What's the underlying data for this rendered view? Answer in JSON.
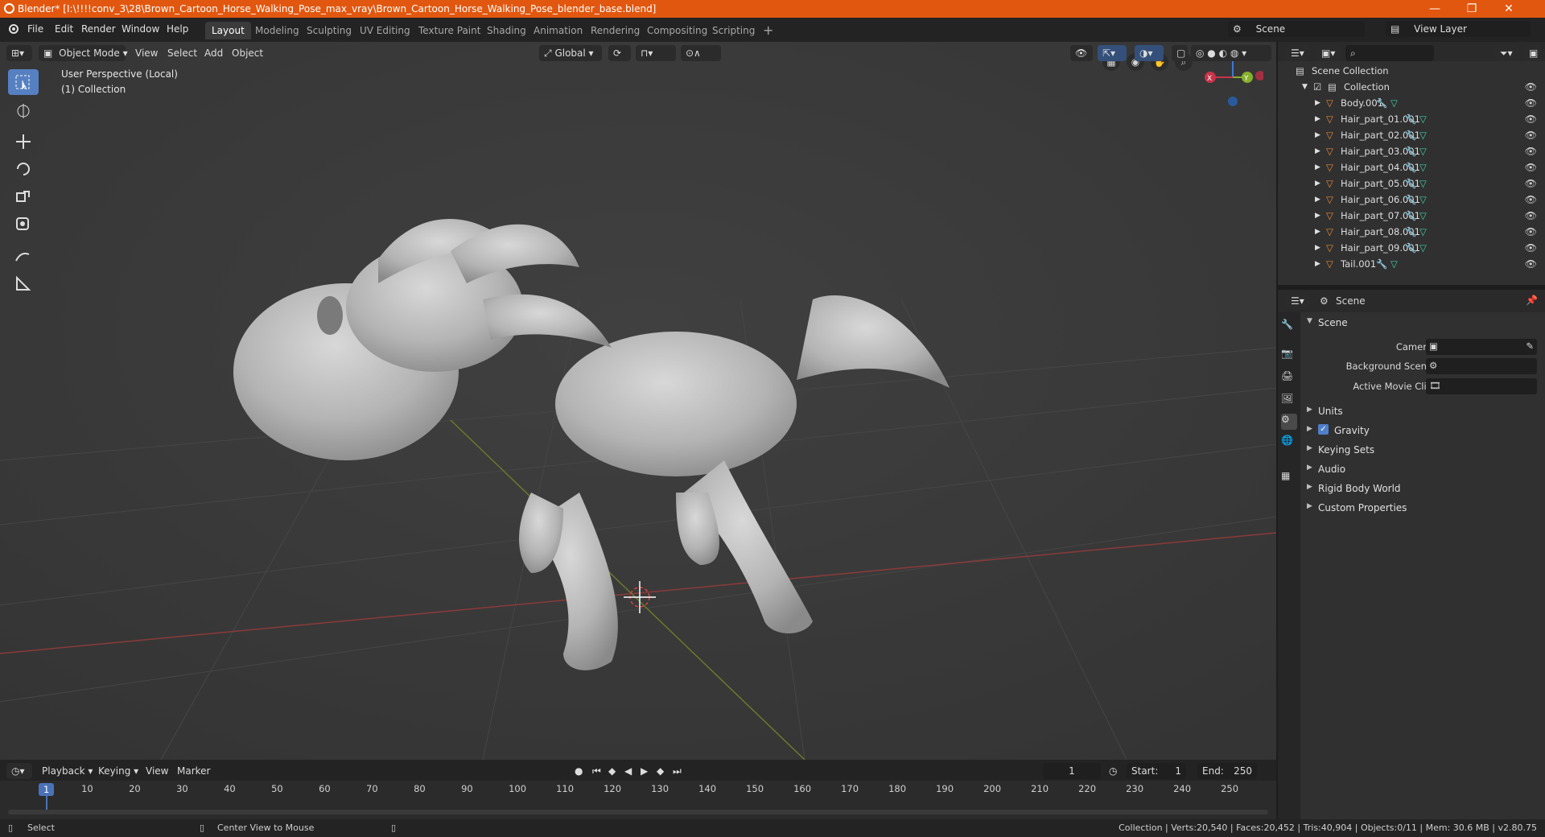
{
  "window": {
    "title": "Blender* [I:\\!!!!conv_3\\28\\Brown_Cartoon_Horse_Walking_Pose_max_vray\\Brown_Cartoon_Horse_Walking_Pose_blender_base.blend]",
    "minimize": "—",
    "maximize": "❐",
    "close": "✕"
  },
  "menu": [
    "File",
    "Edit",
    "Render",
    "Window",
    "Help"
  ],
  "workspaces": [
    "Layout",
    "Modeling",
    "Sculpting",
    "UV Editing",
    "Texture Paint",
    "Shading",
    "Animation",
    "Rendering",
    "Compositing",
    "Scripting"
  ],
  "workspace_add": "+",
  "active_workspace": "Layout",
  "scene_selector": "Scene",
  "view_layer_selector": "View Layer",
  "viewport_header": {
    "mode": "Object Mode",
    "menus": [
      "View",
      "Select",
      "Add",
      "Object"
    ],
    "orientation": "Global"
  },
  "viewport": {
    "perspective_label": "User Perspective (Local)",
    "collection_label": "(1) Collection",
    "gizmo": {
      "x": "X",
      "y": "Y",
      "z": "Z"
    }
  },
  "outliner": {
    "root": "Scene Collection",
    "collection": "Collection",
    "objects": [
      "Body.001",
      "Hair_part_01.001",
      "Hair_part_02.001",
      "Hair_part_03.001",
      "Hair_part_04.001",
      "Hair_part_05.001",
      "Hair_part_06.001",
      "Hair_part_07.001",
      "Hair_part_08.001",
      "Hair_part_09.001",
      "Tail.001"
    ]
  },
  "properties": {
    "header": "Scene",
    "section_title": "Scene",
    "fields": [
      {
        "label": "Camera"
      },
      {
        "label": "Background Scene"
      },
      {
        "label": "Active Movie Clip"
      }
    ],
    "panels": [
      "Units",
      "Gravity",
      "Keying Sets",
      "Audio",
      "Rigid Body World",
      "Custom Properties"
    ],
    "gravity_checked": true
  },
  "timeline": {
    "menus": [
      "Playback",
      "Keying",
      "View",
      "Marker"
    ],
    "current_frame": "1",
    "start_label": "Start:",
    "start": "1",
    "end_label": "End:",
    "end": "250",
    "ticks": [
      "1",
      "10",
      "20",
      "30",
      "40",
      "50",
      "60",
      "70",
      "80",
      "90",
      "100",
      "110",
      "120",
      "130",
      "140",
      "150",
      "160",
      "170",
      "180",
      "190",
      "200",
      "210",
      "220",
      "230",
      "240",
      "250"
    ]
  },
  "statusbar": {
    "select": "Select",
    "center_view": "Center View to Mouse",
    "stats": "Collection | Verts:20,540 | Faces:20,452 | Tris:40,904 | Objects:0/11 | Mem: 30.6 MB | v2.80.75"
  },
  "colors": {
    "titlebar": "#e2570f",
    "accent": "#5680c2",
    "viewport_bg": "#393939",
    "x_axis": "#c8334a",
    "y_axis": "#86b12b",
    "z_axis": "#3b78d8"
  }
}
